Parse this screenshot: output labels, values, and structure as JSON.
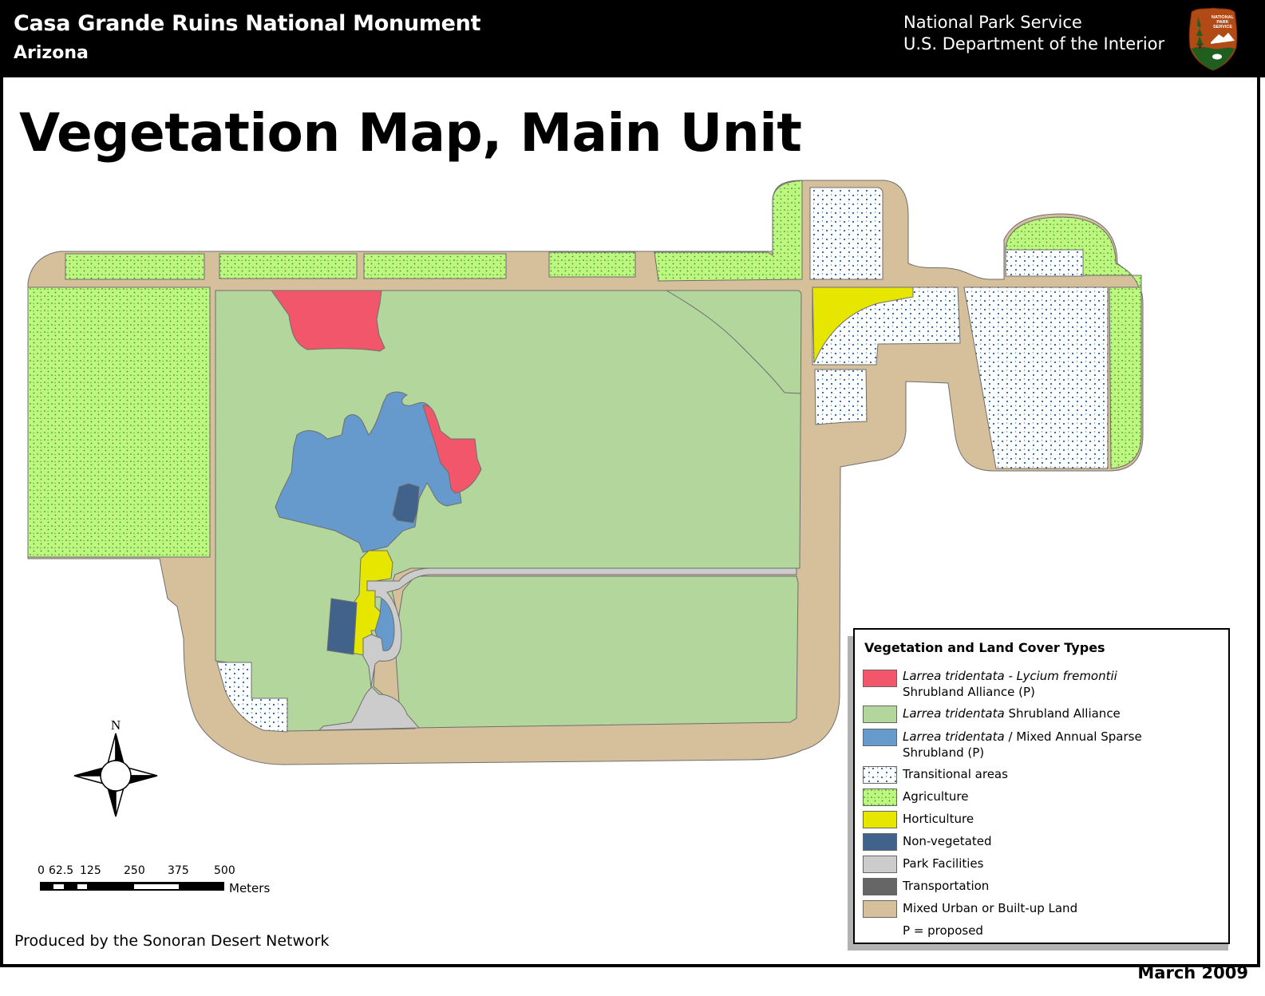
{
  "header": {
    "title": "Casa Grande Ruins National Monument",
    "subtitle": "Arizona",
    "agency_line1": "National Park Service",
    "agency_line2": "U.S. Department of the Interior",
    "logo_icon": "nps-arrowhead-icon",
    "logo_text": [
      "NATIONAL",
      "PARK",
      "SERVICE"
    ]
  },
  "page_title": "Vegetation Map, Main Unit",
  "legend": {
    "title": "Vegetation and Land Cover Types",
    "items": [
      {
        "italic": "Larrea tridentata - Lycium fremontii",
        "text": "",
        "line2": "Shrubland Alliance (P)",
        "color": "#f2566b",
        "pattern": "solid"
      },
      {
        "italic": "Larrea tridentata",
        "text": " Shrubland Alliance",
        "line2": "",
        "color": "#b3d69d",
        "pattern": "solid"
      },
      {
        "italic": "Larrea tridentata",
        "text": " / Mixed Annual Sparse",
        "line2": "Shrubland (P)",
        "color": "#6699cc",
        "pattern": "solid"
      },
      {
        "italic": "",
        "text": "Transitional areas",
        "line2": "",
        "color": "#ffffff",
        "pattern": "blue-dots"
      },
      {
        "italic": "",
        "text": "Agriculture",
        "line2": "",
        "color": "#bff581",
        "pattern": "green-dots"
      },
      {
        "italic": "",
        "text": "Horticulture",
        "line2": "",
        "color": "#e6e600",
        "pattern": "solid"
      },
      {
        "italic": "",
        "text": "Non-vegetated",
        "line2": "",
        "color": "#41628a",
        "pattern": "solid"
      },
      {
        "italic": "",
        "text": "Park Facilities",
        "line2": "",
        "color": "#cccccc",
        "pattern": "solid"
      },
      {
        "italic": "",
        "text": "Transportation",
        "line2": "",
        "color": "#666666",
        "pattern": "solid"
      },
      {
        "italic": "",
        "text": "Mixed Urban or Built-up Land",
        "line2": "",
        "color": "#d6c09c",
        "pattern": "solid"
      }
    ],
    "note": "P = proposed"
  },
  "scale_bar": {
    "labels": [
      "0",
      "62.5",
      "125",
      "250",
      "375",
      "500"
    ],
    "unit": "Meters"
  },
  "compass": {
    "label": "N"
  },
  "footer": {
    "credit": "Produced by the Sonoran Desert Network",
    "date": "March 2009"
  },
  "colors": {
    "red_shrub": "#f2566b",
    "larrea": "#b3d69d",
    "mixed_annual": "#6699cc",
    "agriculture": "#bff581",
    "agri_dot": "#2a9d1a",
    "transit_dot": "#1f5fa8",
    "horticulture": "#e6e600",
    "nonveg": "#41628a",
    "facilities": "#cccccc",
    "urban": "#d6c09c",
    "outline": "#6e6e6e"
  }
}
